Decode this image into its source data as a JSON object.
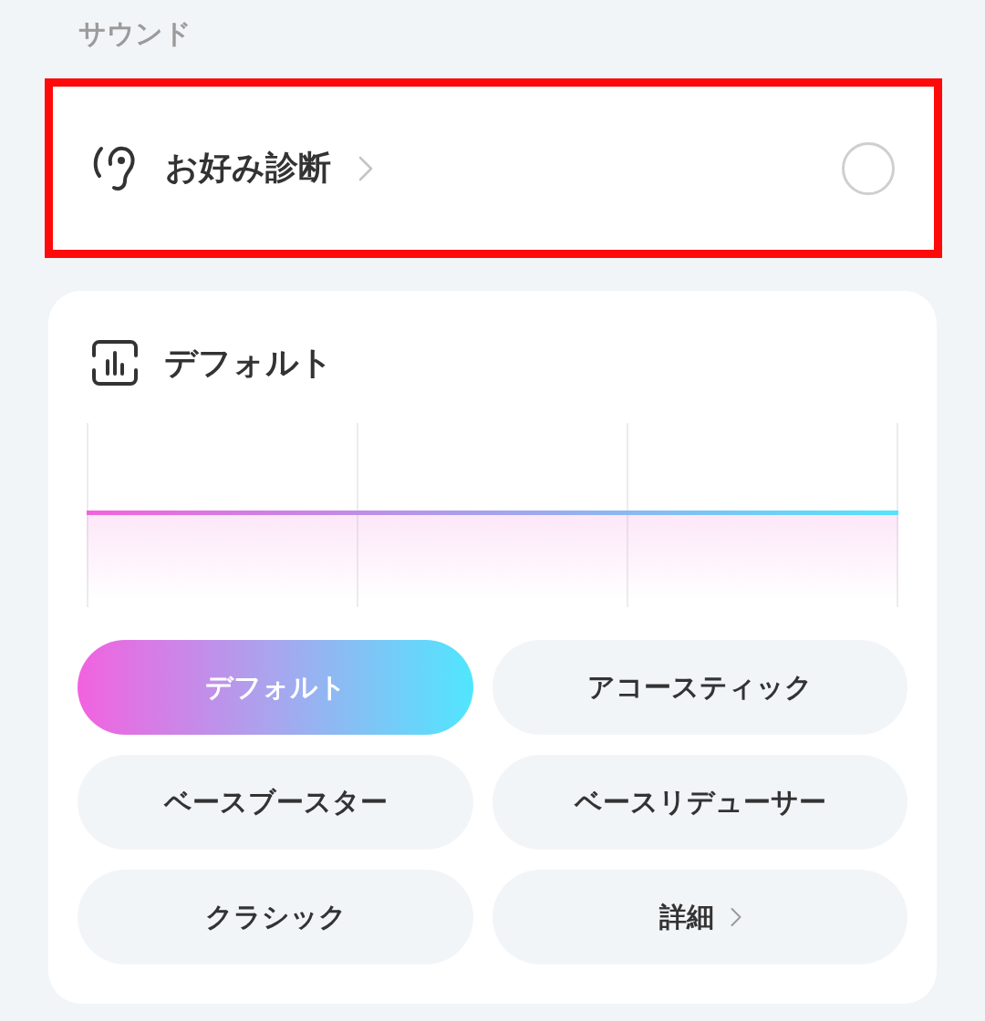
{
  "section_title": "サウンド",
  "preference_test": {
    "label": "お好み診断",
    "selected": false,
    "highlighted": true
  },
  "equalizer": {
    "title": "デフォルト",
    "presets": [
      {
        "label": "デフォルト",
        "kind": "preset",
        "selected": true
      },
      {
        "label": "アコースティック",
        "kind": "preset",
        "selected": false
      },
      {
        "label": "ベースブースター",
        "kind": "preset",
        "selected": false
      },
      {
        "label": "ベースリデューサー",
        "kind": "preset",
        "selected": false
      },
      {
        "label": "クラシック",
        "kind": "preset",
        "selected": false
      },
      {
        "label": "詳細",
        "kind": "more",
        "selected": false
      }
    ]
  }
}
